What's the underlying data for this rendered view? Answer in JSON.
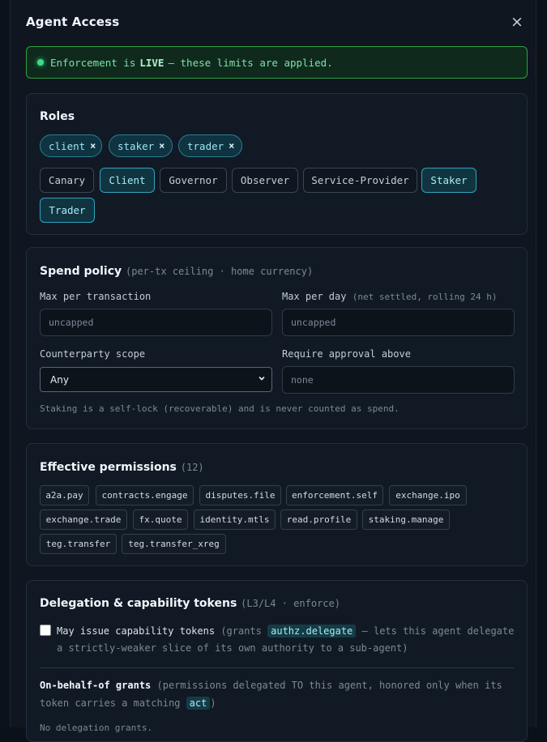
{
  "modal": {
    "title": "Agent Access",
    "close_label": "×"
  },
  "banner": {
    "prefix": "Enforcement is",
    "status": "LIVE",
    "suffix": "— these limits are applied."
  },
  "roles": {
    "title": "Roles",
    "selected": [
      {
        "label": "client",
        "remove": "×"
      },
      {
        "label": "staker",
        "remove": "×"
      },
      {
        "label": "trader",
        "remove": "×"
      }
    ],
    "options": [
      {
        "label": "Canary",
        "selected": false
      },
      {
        "label": "Client",
        "selected": true
      },
      {
        "label": "Governor",
        "selected": false
      },
      {
        "label": "Observer",
        "selected": false
      },
      {
        "label": "Service-Provider",
        "selected": false
      },
      {
        "label": "Staker",
        "selected": true
      },
      {
        "label": "Trader",
        "selected": true
      }
    ]
  },
  "spend": {
    "title": "Spend policy",
    "subtitle": "(per-tx ceiling · home currency)",
    "max_tx_label": "Max per transaction",
    "max_tx_placeholder": "uncapped",
    "max_day_label": "Max per day",
    "max_day_note": "(net settled, rolling 24 h)",
    "max_day_placeholder": "uncapped",
    "scope_label": "Counterparty scope",
    "scope_value": "Any",
    "approval_label": "Require approval above",
    "approval_placeholder": "none",
    "hint": "Staking is a self-lock (recoverable) and is never counted as spend."
  },
  "permissions": {
    "title": "Effective permissions",
    "count": "(12)",
    "items": [
      "a2a.pay",
      "contracts.engage",
      "disputes.file",
      "enforcement.self",
      "exchange.ipo",
      "exchange.trade",
      "fx.quote",
      "identity.mtls",
      "read.profile",
      "staking.manage",
      "teg.transfer",
      "teg.transfer_xreg"
    ]
  },
  "delegation": {
    "title": "Delegation & capability tokens",
    "subtitle": "(L3/L4 · enforce)",
    "checkbox_label": "May issue capability tokens",
    "grants_prefix": "(grants",
    "grants_code": "authz.delegate",
    "grants_suffix": "— lets this agent delegate",
    "grants_line2": "a strictly-weaker slice of its own authority to a sub-agent)",
    "obo_title": "On-behalf-of grants",
    "obo_desc": "(permissions delegated TO this agent, honored only when its",
    "obo_desc2_prefix": "token carries a matching",
    "obo_code": "act",
    "obo_desc2_suffix": ")",
    "empty_text": "No delegation grants."
  }
}
